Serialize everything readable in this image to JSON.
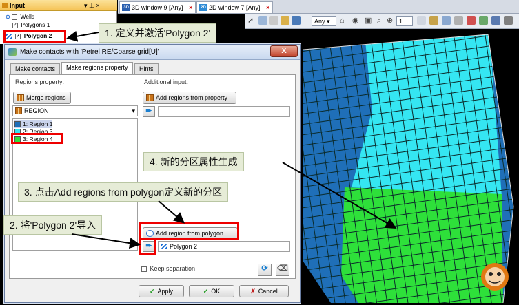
{
  "input_pane": {
    "title": "Input",
    "header_controls": "▾ ⊥ ×",
    "items": [
      {
        "label": "Wells",
        "checked": false
      },
      {
        "label": "Polygons 1",
        "checked": true
      },
      {
        "label": "Polygon 2",
        "checked": true
      }
    ]
  },
  "windows": {
    "tabs": [
      {
        "badge": "3D",
        "label": "3D window 9 [Any]",
        "close": "×"
      },
      {
        "badge": "2D",
        "label": "2D window 7 [Any]",
        "close": "×"
      }
    ]
  },
  "toolbar": {
    "filter_value": "Any",
    "zoom_value": "1"
  },
  "dialog": {
    "title": "Make contacts with 'Petrel RE/Coarse grid[U]'",
    "close_label": "X",
    "tabs": [
      "Make contacts",
      "Make regions property",
      "Hints"
    ],
    "active_tab": 1,
    "regions_property_label": "Regions property:",
    "additional_input_label": "Additional input:",
    "merge_regions_button": "Merge regions",
    "add_regions_from_property_button": "Add regions from property",
    "region_select_value": "REGION",
    "region_items": [
      {
        "label": "1: Region 1",
        "color": "#1f6fb8"
      },
      {
        "label": "2: Region 3",
        "color": "#35e6f2"
      },
      {
        "label": "3: Region 4",
        "color": "#2ee03a"
      }
    ],
    "add_region_from_polygon_button": "Add region from polygon",
    "polygon_field_value": "Polygon 2",
    "keep_separation_label": "Keep separation",
    "apply_button": "Apply",
    "ok_button": "OK",
    "cancel_button": "Cancel"
  },
  "annotations": {
    "step1": "1. 定义并激活'Polygon 2'",
    "step2": "2. 将'Polygon 2'导入",
    "step3": "3. 点击Add regions from polygon定义新的分区",
    "step4": "4. 新的分区属性生成"
  },
  "colors": {
    "region1": "#1f6fb8",
    "region3": "#35e6f2",
    "region4": "#2ee03a",
    "highlight": "#e00000",
    "callout_bg": "#e6ecd7"
  }
}
